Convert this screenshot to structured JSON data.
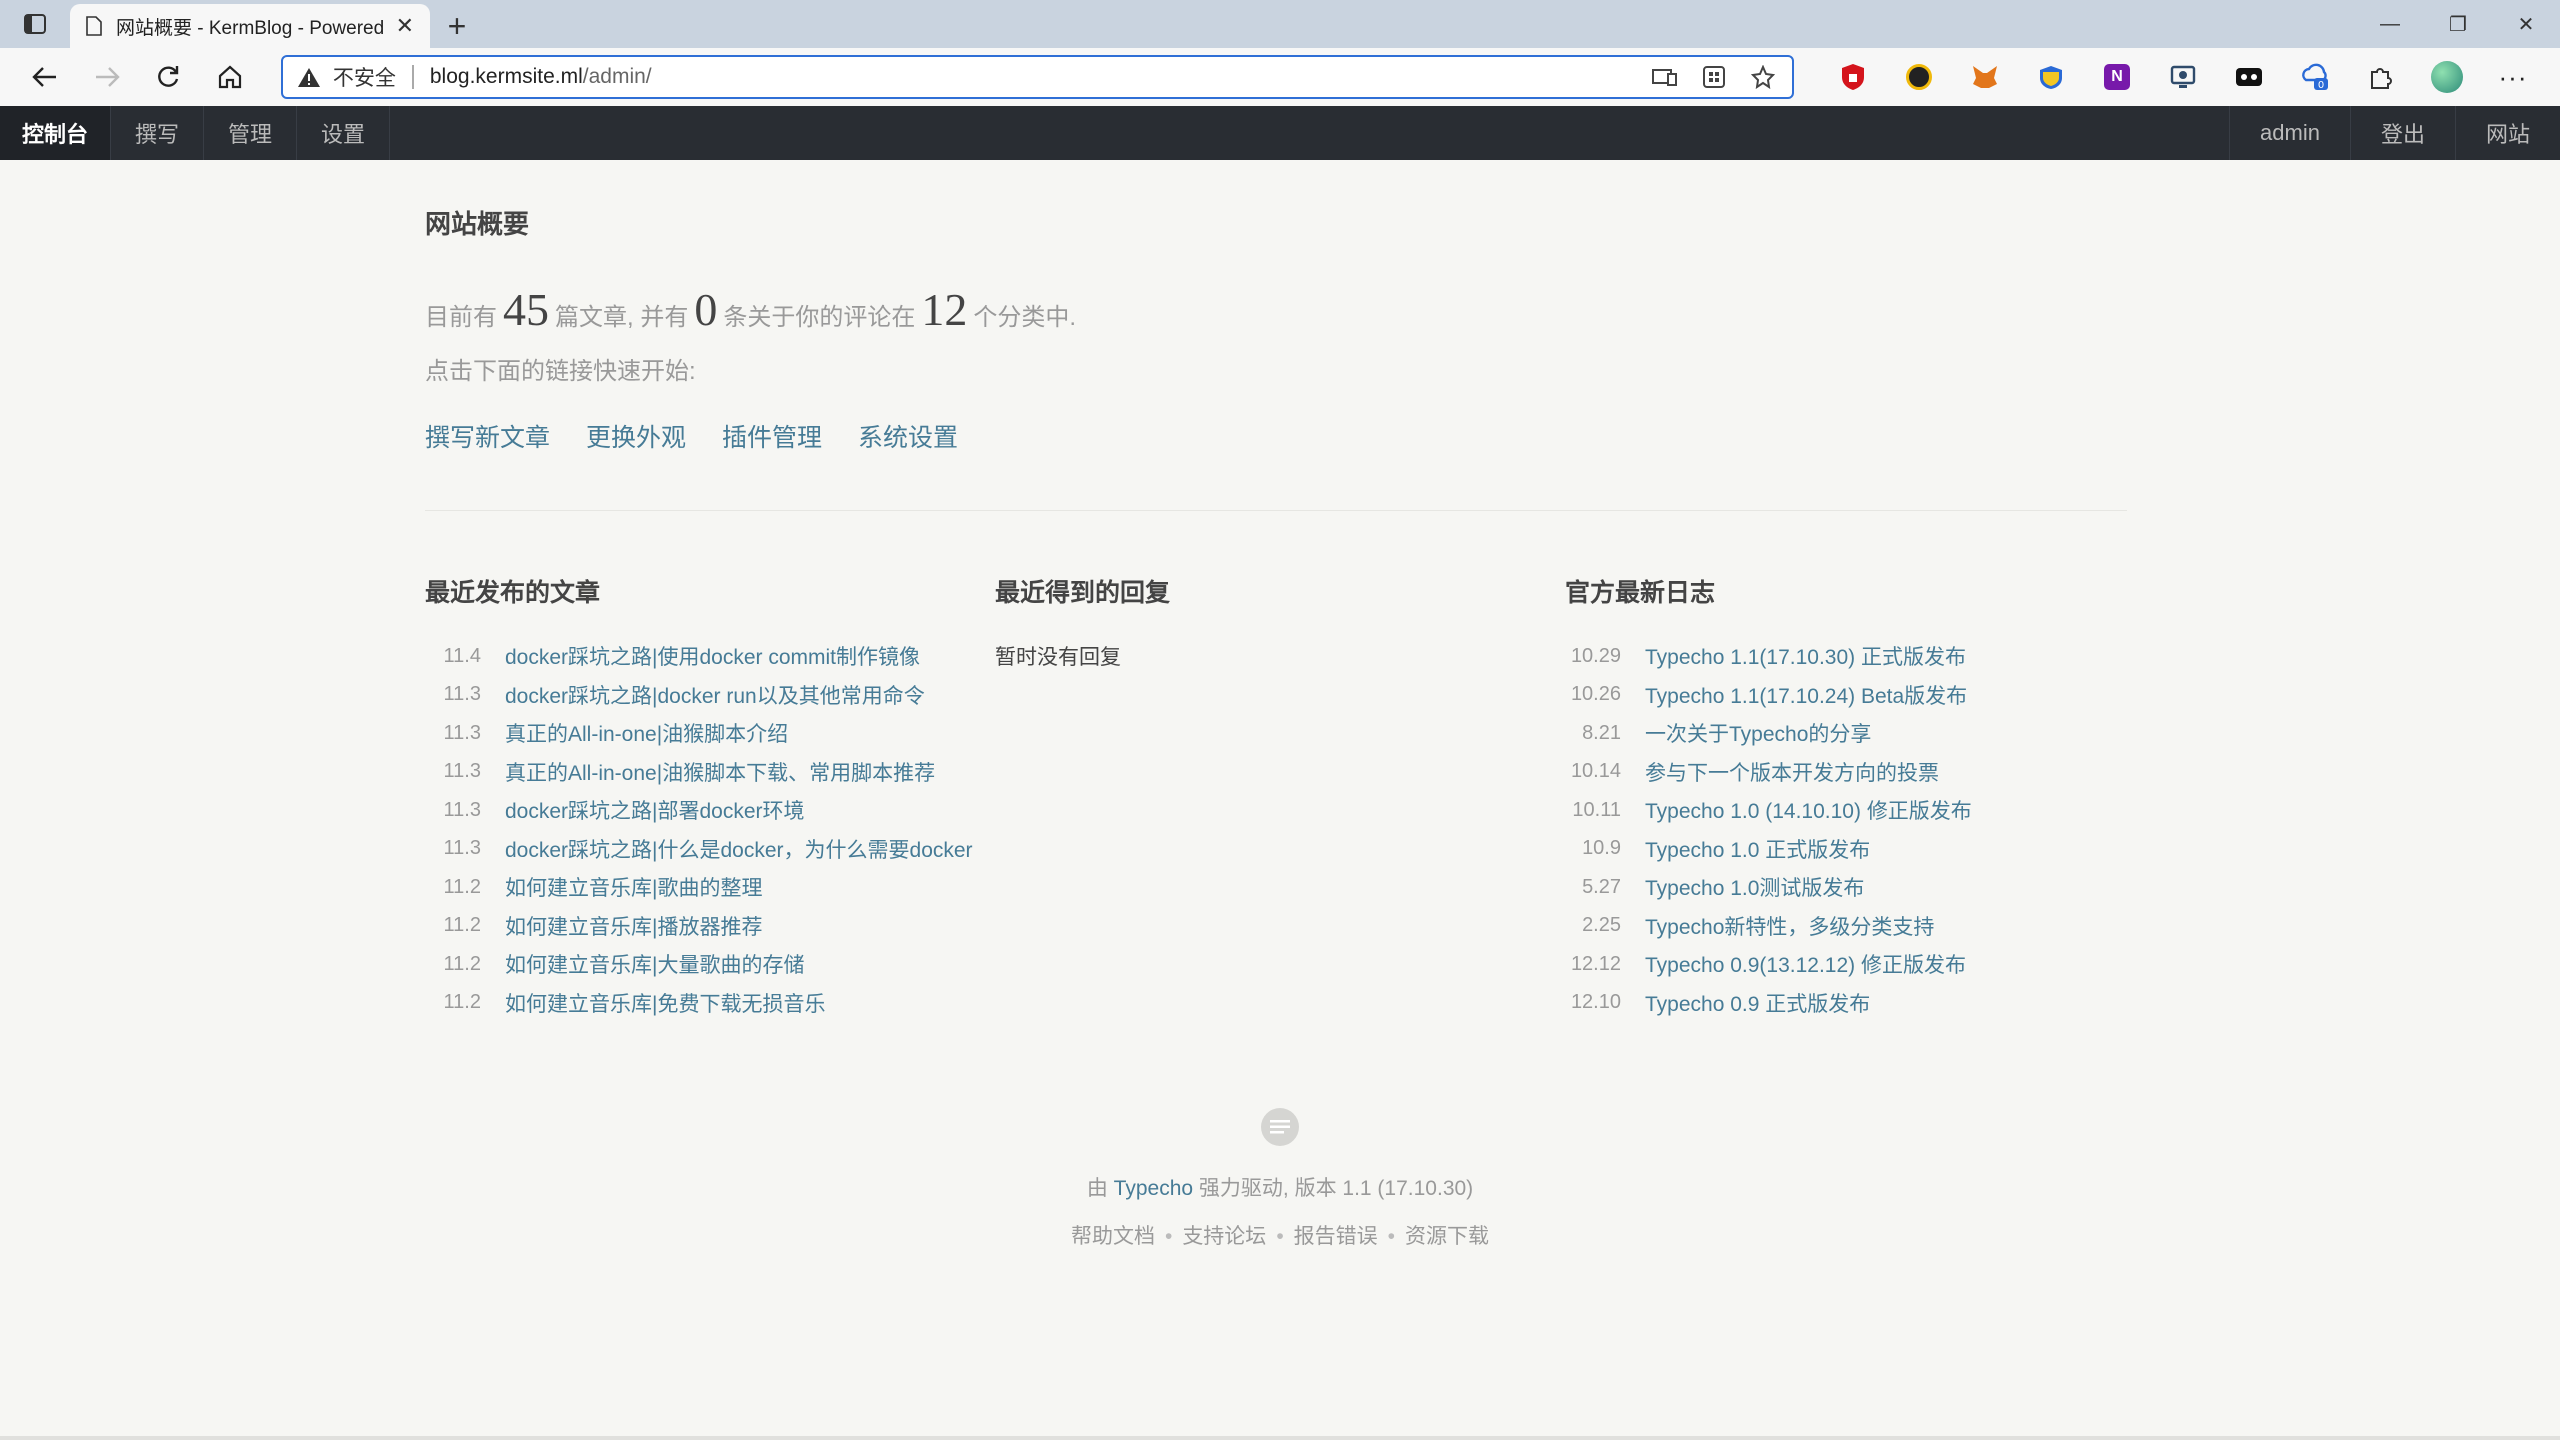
{
  "browser": {
    "tab_title": "网站概要 - KermBlog - Powered",
    "security_label": "不安全",
    "url_host": "blog.kermsite.ml",
    "url_path": "/admin/"
  },
  "admin_nav": {
    "items": [
      {
        "label": "控制台"
      },
      {
        "label": "撰写"
      },
      {
        "label": "管理"
      },
      {
        "label": "设置"
      }
    ],
    "right": [
      {
        "label": "admin"
      },
      {
        "label": "登出"
      },
      {
        "label": "网站"
      }
    ]
  },
  "page": {
    "title": "网站概要",
    "summary": {
      "prefix": "目前有",
      "posts": "45",
      "mid1": "篇文章, 并有",
      "comments": "0",
      "mid2": "条关于你的评论在",
      "categories": "12",
      "suffix": "个分类中."
    },
    "hint": "点击下面的链接快速开始:",
    "quick_links": [
      "撰写新文章",
      "更换外观",
      "插件管理",
      "系统设置"
    ]
  },
  "recent_posts": {
    "heading": "最近发布的文章",
    "items": [
      {
        "date": "11.4",
        "title": "docker踩坑之路|使用docker commit制作镜像"
      },
      {
        "date": "11.3",
        "title": "docker踩坑之路|docker run以及其他常用命令"
      },
      {
        "date": "11.3",
        "title": "真正的All-in-one|油猴脚本介绍"
      },
      {
        "date": "11.3",
        "title": "真正的All-in-one|油猴脚本下载、常用脚本推荐"
      },
      {
        "date": "11.3",
        "title": "docker踩坑之路|部署docker环境"
      },
      {
        "date": "11.3",
        "title": "docker踩坑之路|什么是docker，为什么需要docker"
      },
      {
        "date": "11.2",
        "title": "如何建立音乐库|歌曲的整理"
      },
      {
        "date": "11.2",
        "title": "如何建立音乐库|播放器推荐"
      },
      {
        "date": "11.2",
        "title": "如何建立音乐库|大量歌曲的存储"
      },
      {
        "date": "11.2",
        "title": "如何建立音乐库|免费下载无损音乐"
      }
    ]
  },
  "recent_replies": {
    "heading": "最近得到的回复",
    "empty": "暂时没有回复"
  },
  "official_log": {
    "heading": "官方最新日志",
    "items": [
      {
        "date": "10.29",
        "title": "Typecho 1.1(17.10.30) 正式版发布"
      },
      {
        "date": "10.26",
        "title": "Typecho 1.1(17.10.24) Beta版发布"
      },
      {
        "date": "8.21",
        "title": "一次关于Typecho的分享"
      },
      {
        "date": "10.14",
        "title": "参与下一个版本开发方向的投票"
      },
      {
        "date": "10.11",
        "title": "Typecho 1.0 (14.10.10) 修正版发布"
      },
      {
        "date": "10.9",
        "title": "Typecho 1.0 正式版发布"
      },
      {
        "date": "5.27",
        "title": "Typecho 1.0测试版发布"
      },
      {
        "date": "2.25",
        "title": "Typecho新特性，多级分类支持"
      },
      {
        "date": "12.12",
        "title": "Typecho 0.9(13.12.12) 修正版发布"
      },
      {
        "date": "12.10",
        "title": "Typecho 0.9 正式版发布"
      }
    ]
  },
  "footer": {
    "by": "由",
    "product": "Typecho",
    "powered_suffix": "强力驱动, 版本 1.1 (17.10.30)",
    "links": [
      "帮助文档",
      "支持论坛",
      "报告错误",
      "资源下载"
    ]
  }
}
